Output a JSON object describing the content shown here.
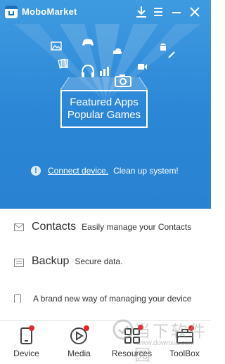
{
  "titlebar": {
    "app_name": "MoboMarket"
  },
  "hero": {
    "line1": "Featured Apps",
    "line2": "Popular Games",
    "connect_link": "Connect device.",
    "connect_rest": "Clean up system!"
  },
  "features": {
    "contacts_title": "Contacts",
    "contacts_desc": "Easily manage your Contacts",
    "backup_title": "Backup",
    "backup_desc": "Secure data.",
    "device_desc": "A brand new way of managing your device"
  },
  "nav": {
    "device": "Device",
    "media": "Media",
    "resources": "Resources",
    "toolbox": "ToolBox"
  },
  "watermark": {
    "text": "当下软件园",
    "url": "www.downxia.com"
  },
  "colors": {
    "hero_blue": "#2b86d6",
    "badge_red": "#e8262f"
  }
}
